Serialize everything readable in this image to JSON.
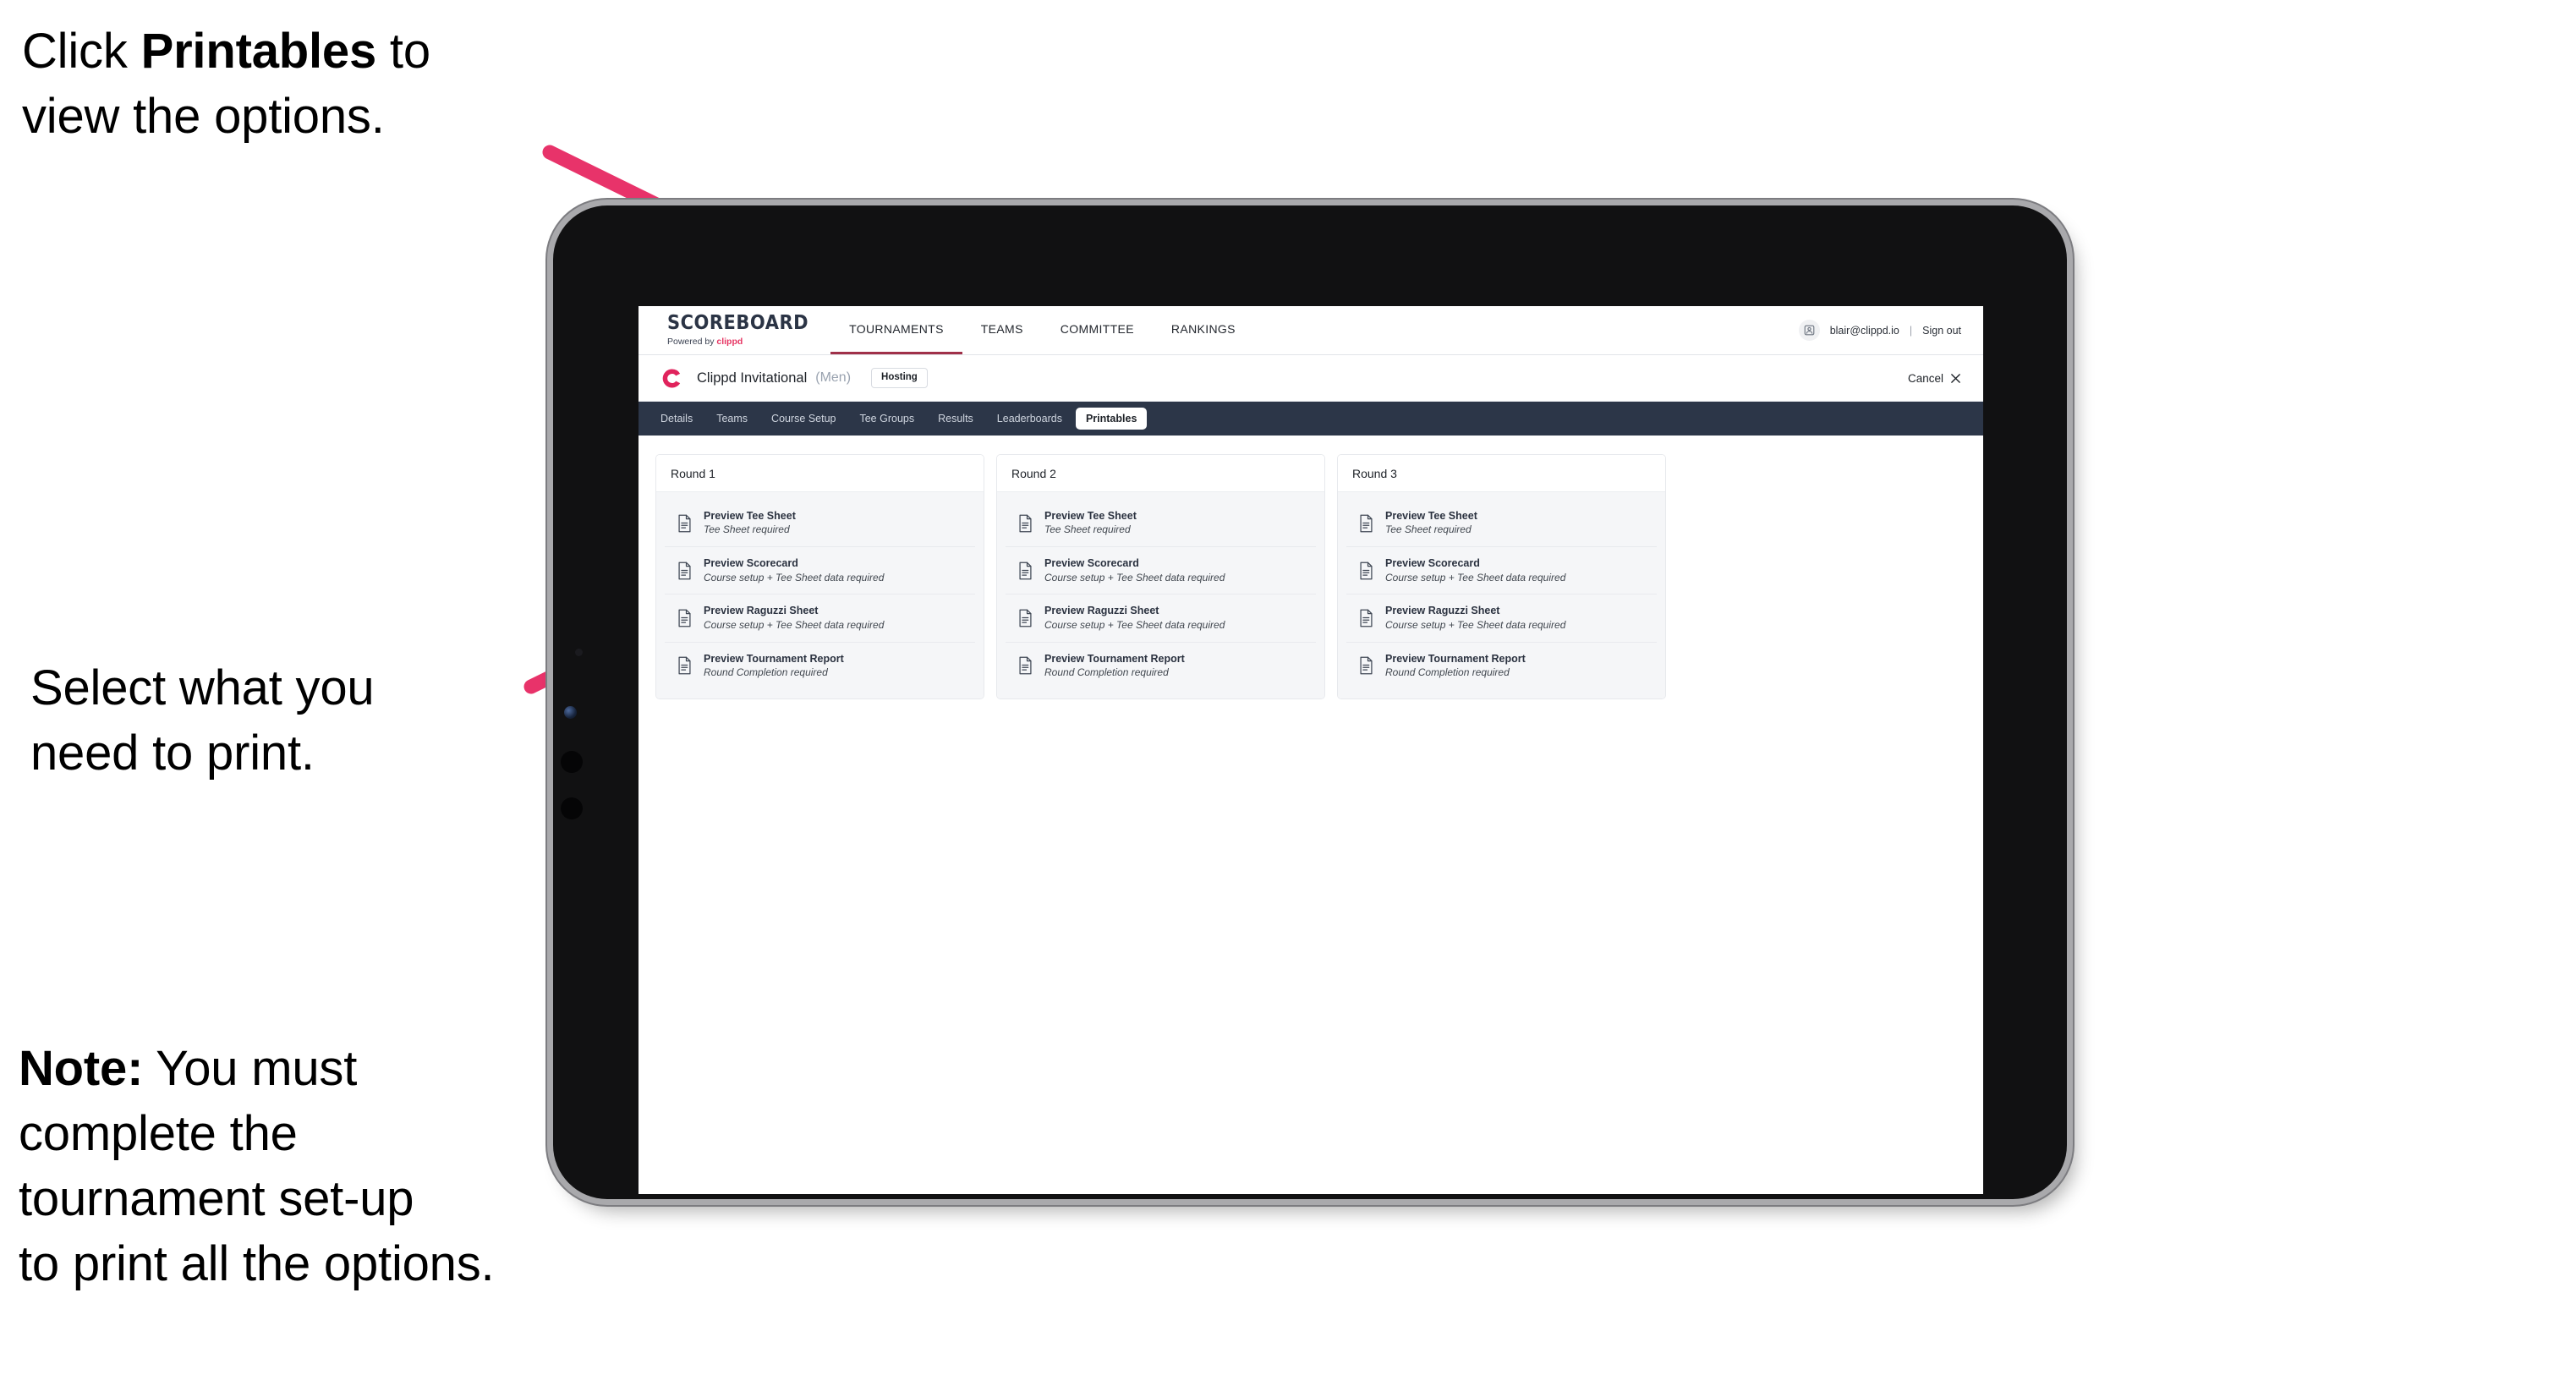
{
  "annotations": {
    "click_printables": {
      "pre": "Click ",
      "bold": "Printables",
      "post": " to\nview the options."
    },
    "select_print": "Select what you\n need to print.",
    "note": {
      "bold": "Note:",
      "text": " You must\ncomplete the\ntournament set-up\nto print all the options."
    }
  },
  "colors": {
    "accent_pink": "#e8336a",
    "brand_pink": "#e63462",
    "subnav_bg": "#2c3648",
    "active_underline": "#a03049"
  },
  "app": {
    "brand": {
      "word": "SCOREBOARD",
      "powered_prefix": "Powered by ",
      "powered_name": "clippd"
    },
    "main_nav": [
      {
        "label": "TOURNAMENTS",
        "active": true
      },
      {
        "label": "TEAMS",
        "active": false
      },
      {
        "label": "COMMITTEE",
        "active": false
      },
      {
        "label": "RANKINGS",
        "active": false
      }
    ],
    "user": {
      "avatar_icon": "user-avatar-icon",
      "email": "blair@clippd.io",
      "separator": "|",
      "sign_out": "Sign out"
    },
    "tournament_bar": {
      "logo_icon": "clippd-c-logo-icon",
      "name": "Clippd Invitational",
      "gender": "(Men)",
      "status_badge": "Hosting",
      "cancel_label": "Cancel",
      "close_icon": "close-x-icon"
    },
    "sub_nav": [
      {
        "label": "Details",
        "active": false
      },
      {
        "label": "Teams",
        "active": false
      },
      {
        "label": "Course Setup",
        "active": false
      },
      {
        "label": "Tee Groups",
        "active": false
      },
      {
        "label": "Results",
        "active": false
      },
      {
        "label": "Leaderboards",
        "active": false
      },
      {
        "label": "Printables",
        "active": true
      }
    ],
    "rounds": [
      {
        "title": "Round 1",
        "items": [
          {
            "icon": "document-icon",
            "title": "Preview Tee Sheet",
            "subtitle": "Tee Sheet required"
          },
          {
            "icon": "document-icon",
            "title": "Preview Scorecard",
            "subtitle": "Course setup + Tee Sheet data required"
          },
          {
            "icon": "document-icon",
            "title": "Preview Raguzzi Sheet",
            "subtitle": "Course setup + Tee Sheet data required"
          },
          {
            "icon": "document-icon",
            "title": "Preview Tournament Report",
            "subtitle": "Round Completion required"
          }
        ]
      },
      {
        "title": "Round 2",
        "items": [
          {
            "icon": "document-icon",
            "title": "Preview Tee Sheet",
            "subtitle": "Tee Sheet required"
          },
          {
            "icon": "document-icon",
            "title": "Preview Scorecard",
            "subtitle": "Course setup + Tee Sheet data required"
          },
          {
            "icon": "document-icon",
            "title": "Preview Raguzzi Sheet",
            "subtitle": "Course setup + Tee Sheet data required"
          },
          {
            "icon": "document-icon",
            "title": "Preview Tournament Report",
            "subtitle": "Round Completion required"
          }
        ]
      },
      {
        "title": "Round 3",
        "items": [
          {
            "icon": "document-icon",
            "title": "Preview Tee Sheet",
            "subtitle": "Tee Sheet required"
          },
          {
            "icon": "document-icon",
            "title": "Preview Scorecard",
            "subtitle": "Course setup + Tee Sheet data required"
          },
          {
            "icon": "document-icon",
            "title": "Preview Raguzzi Sheet",
            "subtitle": "Course setup + Tee Sheet data required"
          },
          {
            "icon": "document-icon",
            "title": "Preview Tournament Report",
            "subtitle": "Round Completion required"
          }
        ]
      }
    ]
  }
}
